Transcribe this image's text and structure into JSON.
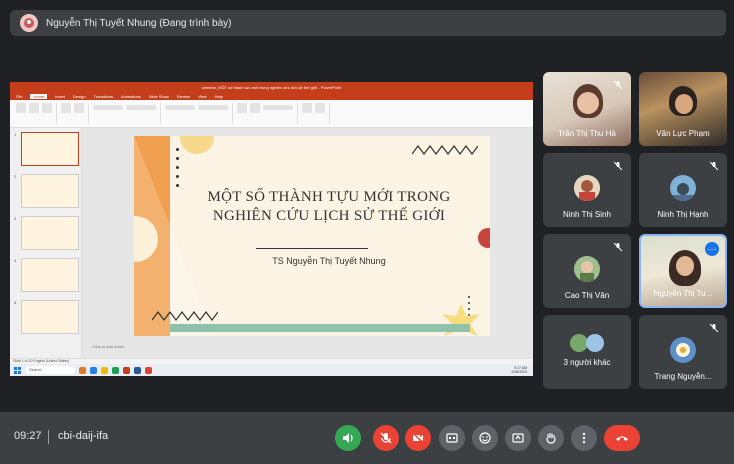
{
  "presenter": {
    "name": "Nguyễn Thị Tuyết Nhung (Đang trình bày)"
  },
  "share": {
    "window_title": "seminar_MỘT số thành tựu mới trong nghiên cứu lịch sử thế giới - PowerPoint",
    "ribbon_tabs": [
      "File",
      "Home",
      "Insert",
      "Design",
      "Transitions",
      "Animations",
      "Slide Show",
      "Review",
      "View",
      "Help"
    ],
    "slide": {
      "title_line1": "MỘT SỐ THÀNH TỰU MỚI TRONG",
      "title_line2": "NGHIÊN CỨU LỊCH SỬ THẾ GIỚI",
      "author": "TS Nguyễn Thị Tuyết Nhung"
    },
    "notes_placeholder": "Click to add notes",
    "status_left": "Slide 1 of 10   English (United States)",
    "taskbar_search": "Search",
    "taskbar_time": "9:27 AM",
    "taskbar_date": "2/28/2024",
    "colors": {
      "ppt_brand": "#c43e1c",
      "slide_bg": "#fbf4e4",
      "slide_orange": "#f0a050"
    }
  },
  "participants": [
    {
      "name": "Trần Thị Thu Hà",
      "kind": "video"
    },
    {
      "name": "Văn Lực Phạm",
      "kind": "video"
    },
    {
      "name": "Ninh Thị Sinh",
      "kind": "avatar"
    },
    {
      "name": "Ninh Thị Hạnh",
      "kind": "avatar"
    },
    {
      "name": "Cao Thị Vân",
      "kind": "avatar"
    },
    {
      "name": "Nguyễn Thị Tu...",
      "kind": "video"
    },
    {
      "name": "3 người khác",
      "kind": "group"
    },
    {
      "name": "Trang Nguyễn...",
      "kind": "avatar"
    }
  ],
  "controls": {
    "time": "09:27",
    "meeting_code": "cbi-daij-ifa",
    "buttons": [
      "speaker-icon",
      "mic-off-icon",
      "camera-off-icon",
      "captions-icon",
      "emoji-icon",
      "present-icon",
      "raise-hand-icon",
      "more-options-icon",
      "hang-up-icon"
    ],
    "colors": {
      "green": "#34a853",
      "red": "#ea4335",
      "gray": "#5f6368"
    }
  }
}
